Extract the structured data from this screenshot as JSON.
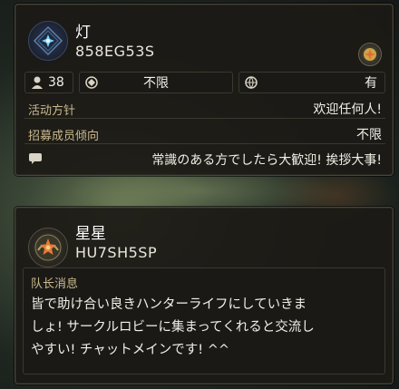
{
  "circle1": {
    "name": "灯",
    "code": "858EG53S",
    "stats": {
      "members_count": "38",
      "requirement": "不限",
      "availability": "有"
    },
    "policy_label": "活动方针",
    "policy_value": "欢迎任何人!",
    "recruit_label": "招募成员倾向",
    "recruit_value": "不限",
    "comment": "常識のある方でしたら大歓迎! 挨拶大事!"
  },
  "circle2": {
    "name": "星星",
    "code": "HU7SH5SP",
    "leader_message_label": "队长消息",
    "leader_message_line1": "皆で助け合い良きハンターライフにしていきま",
    "leader_message_line2": "しょ! サークルロビーに集まってくれると交流し",
    "leader_message_line3": "やすい! チャットメインです! ^^"
  },
  "colors": {
    "label_gold": "#c9b98d",
    "panel_bg": "#1c1a16",
    "text": "#f2efe6"
  },
  "icons": {
    "emblem1": "blue-star-emblem-icon",
    "emblem2": "gold-star-emblem-icon",
    "members": "person-icon",
    "requirement": "hunter-rank-icon",
    "availability": "globe-icon",
    "comment": "chat-bubble-icon"
  }
}
